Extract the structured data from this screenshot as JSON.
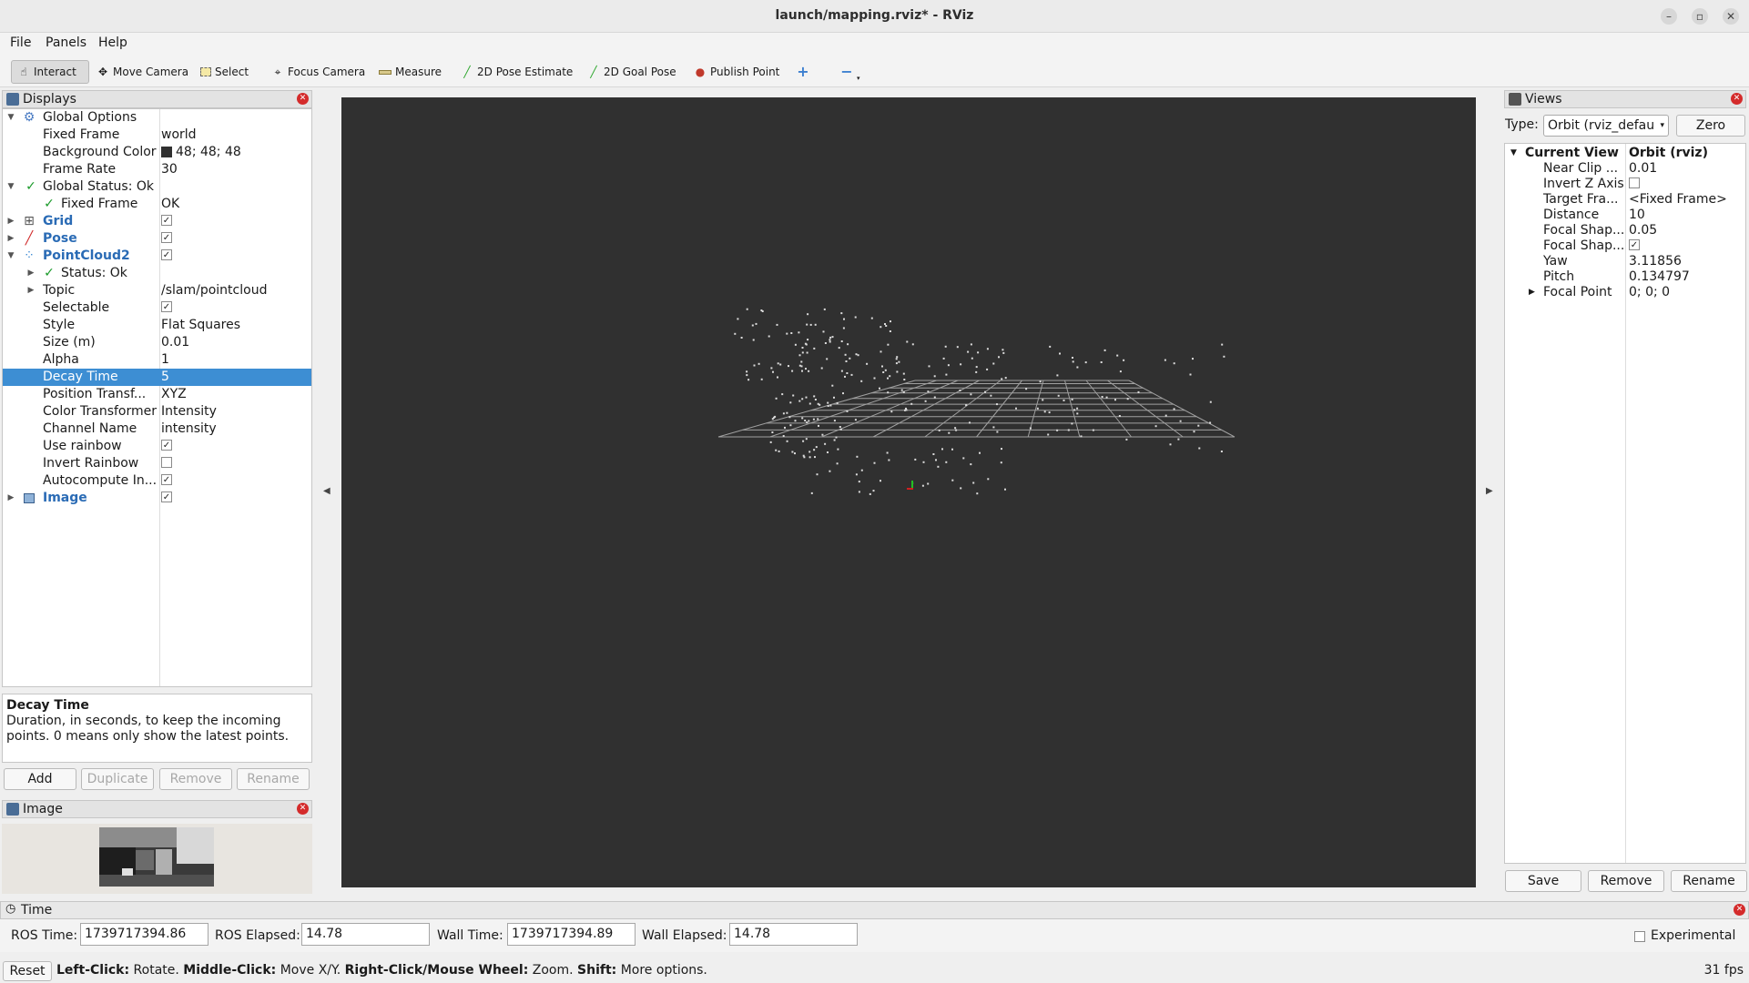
{
  "window": {
    "title": "launch/mapping.rviz* - RViz",
    "minimize_glyph": "–",
    "maximize_glyph": "▫",
    "close_glyph": "✕"
  },
  "menu": [
    "File",
    "Panels",
    "Help"
  ],
  "toolbar": {
    "interact": "Interact",
    "move_camera": "Move Camera",
    "select": "Select",
    "focus_camera": "Focus Camera",
    "measure": "Measure",
    "pose_estimate": "2D Pose Estimate",
    "goal_pose": "2D Goal Pose",
    "publish_point": "Publish Point"
  },
  "displays": {
    "title": "Displays",
    "rows": {
      "global_options": {
        "name": "Global Options"
      },
      "fixed_frame": {
        "name": "Fixed Frame",
        "value": "world"
      },
      "background_color": {
        "name": "Background Color",
        "value": "48; 48; 48"
      },
      "frame_rate": {
        "name": "Frame Rate",
        "value": "30"
      },
      "global_status": {
        "name": "Global Status: Ok"
      },
      "fixed_frame_status": {
        "name": "Fixed Frame",
        "value": "OK"
      },
      "grid": {
        "name": "Grid",
        "checked": true
      },
      "pose": {
        "name": "Pose",
        "checked": true
      },
      "pointcloud2": {
        "name": "PointCloud2",
        "checked": true
      },
      "status_ok": {
        "name": "Status: Ok"
      },
      "topic": {
        "name": "Topic",
        "value": "/slam/pointcloud"
      },
      "selectable": {
        "name": "Selectable",
        "checked": true
      },
      "style": {
        "name": "Style",
        "value": "Flat Squares"
      },
      "size": {
        "name": "Size (m)",
        "value": "0.01"
      },
      "alpha": {
        "name": "Alpha",
        "value": "1"
      },
      "decay_time": {
        "name": "Decay Time",
        "value": "5"
      },
      "position_transformer": {
        "name": "Position Transf...",
        "value": "XYZ"
      },
      "color_transformer": {
        "name": "Color Transformer",
        "value": "Intensity"
      },
      "channel_name": {
        "name": "Channel Name",
        "value": "intensity"
      },
      "use_rainbow": {
        "name": "Use rainbow",
        "checked": true
      },
      "invert_rainbow": {
        "name": "Invert Rainbow",
        "checked": false
      },
      "autocompute": {
        "name": "Autocompute In...",
        "checked": true
      },
      "image": {
        "name": "Image",
        "checked": true
      }
    },
    "description": {
      "title": "Decay Time",
      "text": "Duration, in seconds, to keep the incoming points. 0 means only show the latest points."
    },
    "buttons": {
      "add": "Add",
      "duplicate": "Duplicate",
      "remove": "Remove",
      "rename": "Rename"
    }
  },
  "image_panel": {
    "title": "Image"
  },
  "views": {
    "title": "Views",
    "type_label": "Type:",
    "type_value": "Orbit (rviz_defau",
    "zero_button": "Zero",
    "current_view": {
      "name": "Current View",
      "value": "Orbit (rviz)"
    },
    "props": [
      {
        "name": "Near Clip ...",
        "value": "0.01"
      },
      {
        "name": "Invert Z Axis",
        "value": ""
      },
      {
        "name": "Target Fra...",
        "value": "<Fixed Frame>"
      },
      {
        "name": "Distance",
        "value": "10"
      },
      {
        "name": "Focal Shap...",
        "value": "0.05"
      },
      {
        "name": "Focal Shap...",
        "value": ""
      },
      {
        "name": "Yaw",
        "value": "3.11856"
      },
      {
        "name": "Pitch",
        "value": "0.134797"
      },
      {
        "name": "Focal Point",
        "value": "0; 0; 0"
      }
    ],
    "buttons": {
      "save": "Save",
      "remove": "Remove",
      "rename": "Rename"
    }
  },
  "time": {
    "title": "Time",
    "ros_time_label": "ROS Time:",
    "ros_time": "1739717394.86",
    "ros_elapsed_label": "ROS Elapsed:",
    "ros_elapsed": "14.78",
    "wall_time_label": "Wall Time:",
    "wall_time": "1739717394.89",
    "wall_elapsed_label": "Wall Elapsed:",
    "wall_elapsed": "14.78",
    "experimental": "Experimental"
  },
  "status": {
    "reset": "Reset",
    "left_click": "Left-Click:",
    "left_click_text": " Rotate. ",
    "middle_click": "Middle-Click:",
    "middle_click_text": " Move X/Y. ",
    "right_click": "Right-Click/Mouse Wheel:",
    "right_click_text": " Zoom. ",
    "shift": "Shift:",
    "shift_text": " More options.",
    "fps": "31 fps"
  }
}
